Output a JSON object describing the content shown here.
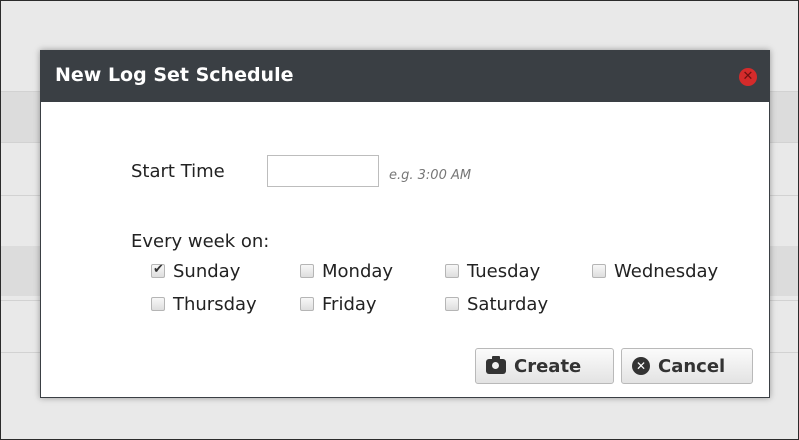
{
  "dialog": {
    "title": "New Log Set Schedule",
    "start_time_label": "Start Time",
    "start_time_value": "",
    "start_time_hint": "e.g. 3:00 AM",
    "every_week_label": "Every week on:",
    "days": [
      {
        "label": "Sunday",
        "checked": true
      },
      {
        "label": "Monday",
        "checked": false
      },
      {
        "label": "Tuesday",
        "checked": false
      },
      {
        "label": "Wednesday",
        "checked": false
      },
      {
        "label": "Thursday",
        "checked": false
      },
      {
        "label": "Friday",
        "checked": false
      },
      {
        "label": "Saturday",
        "checked": false
      }
    ],
    "create_label": "Create",
    "cancel_label": "Cancel",
    "close_icon": "close-circle-icon",
    "create_icon": "camera-icon",
    "cancel_icon": "x-circle-icon"
  },
  "colors": {
    "titlebar": "#3a3f44",
    "close": "#d42b2b"
  }
}
